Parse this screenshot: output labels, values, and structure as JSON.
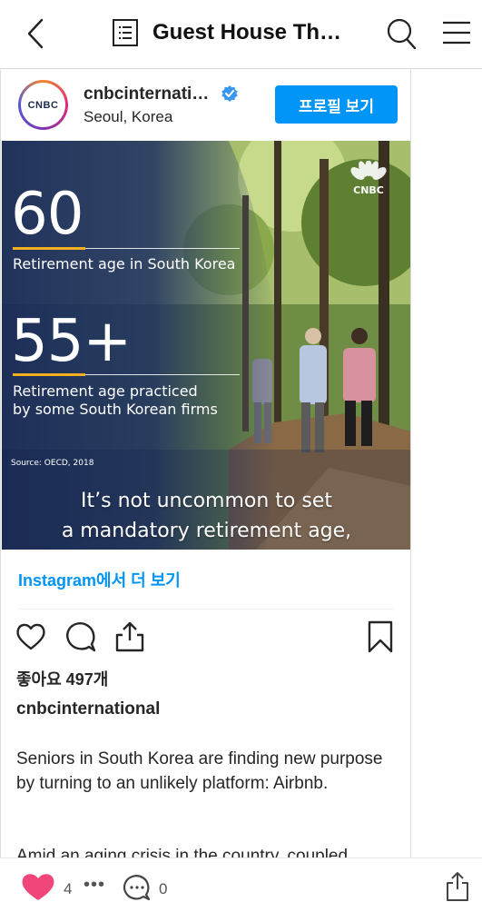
{
  "topbar": {
    "title": "Guest House Th…",
    "icons": [
      "back-icon",
      "document-list-icon",
      "search-icon",
      "menu-icon"
    ]
  },
  "post": {
    "avatar_logo": "CNBC",
    "username": "cnbcinternati…",
    "location": "Seoul, Korea",
    "profile_button": "프로필 보기",
    "image": {
      "brand": "CNBC",
      "stat1_value": "60",
      "stat1_label": "Retirement age in South Korea",
      "stat2_value": "55+",
      "stat2_label_line1": "Retirement age practiced",
      "stat2_label_line2": "by some South Korean firms",
      "source": "Source: OECD, 2018",
      "subtitle_line1": "It’s not uncommon to set",
      "subtitle_line2": "a mandatory retirement age,",
      "accent_color": "#f2b01e"
    },
    "more_link": "Instagram에서 더 보기",
    "likes": "좋아요 497개",
    "caption_user": "cnbcinternational",
    "caption": "Seniors in South Korea are finding new purpose by turning to an unlikely platform: Airbnb.",
    "caption2": "Amid an aging crisis in the country, coupled"
  },
  "bottombar": {
    "like_count": "4",
    "dots": "•••",
    "comment_count": "0"
  },
  "colors": {
    "accent": "#0095f6",
    "heart": "#f0467a"
  }
}
